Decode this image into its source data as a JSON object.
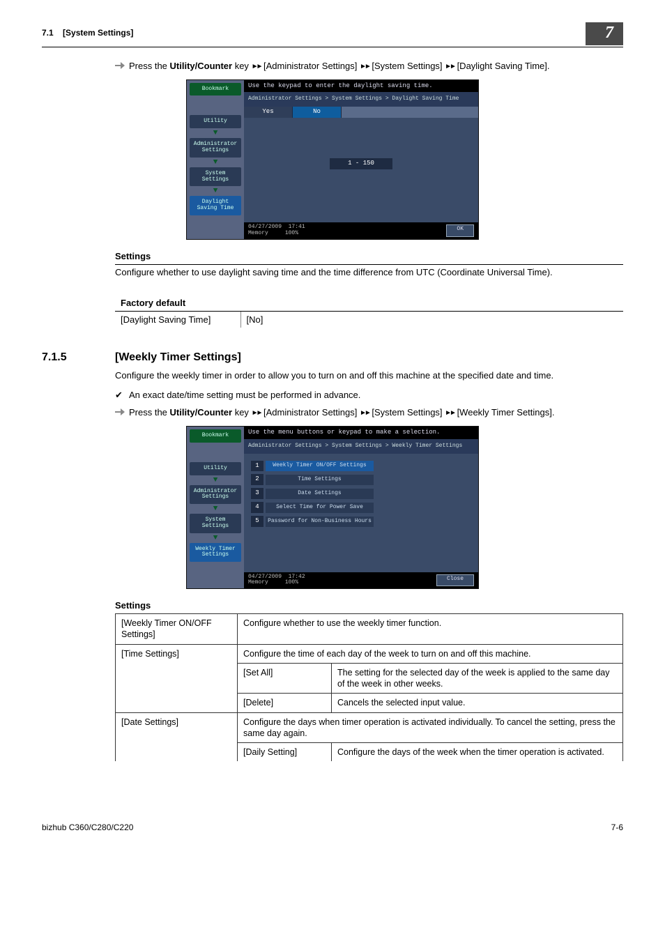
{
  "header": {
    "section_no": "7.1",
    "section_title": "[System Settings]",
    "chapter_badge": "7"
  },
  "instr1": {
    "prefix": "Press the ",
    "key_bold": "Utility/Counter",
    "key_after": " key ",
    "path": " [Administrator Settings] ",
    "path2": " [System Settings] ",
    "path3": " [Daylight Saving Time].",
    "triangle": "►►"
  },
  "lcd1": {
    "top_msg": "Use the keypad to enter the daylight saving time.",
    "crumb": "Administrator Settings > System Settings > Daylight Saving Time",
    "tab_yes": "Yes",
    "tab_no": "No",
    "side": {
      "bookmark": "Bookmark",
      "utility": "Utility",
      "admin": "Administrator Settings",
      "system": "System Settings",
      "dst": "Daylight Saving Time"
    },
    "center": "1  -  150",
    "status_date": "04/27/2009",
    "status_time": "17:41",
    "status_mem": "Memory",
    "status_pct": "100%",
    "ok": "OK"
  },
  "settings_h": "Settings",
  "settings_p1": "Configure whether to use daylight saving time and the time difference from UTC (Coordinate Universal Time).",
  "factory_h": "Factory default",
  "factory_row_label": "[Daylight Saving Time]",
  "factory_row_val": "[No]",
  "sec715_no": "7.1.5",
  "sec715_title": "[Weekly Timer Settings]",
  "sec715_intro": "Configure the weekly timer in order to allow you to turn on and off this machine at the specified date and time.",
  "check1": "An exact date/time setting must be performed in advance.",
  "instr2": {
    "prefix": "Press the ",
    "key_bold": "Utility/Counter",
    "key_after": " key ",
    "path": " [Administrator Settings] ",
    "path2": " [System Settings] ",
    "path3": " [Weekly Timer Settings].",
    "triangle": "►►"
  },
  "lcd2": {
    "top_msg": "Use the menu buttons or keypad to make a selection.",
    "crumb": "Administrator Settings > System Settings > Weekly Timer Settings",
    "side": {
      "bookmark": "Bookmark",
      "utility": "Utility",
      "admin": "Administrator Settings",
      "system": "System Settings",
      "weekly": "Weekly Timer Settings"
    },
    "menu": {
      "m1": "Weekly Timer ON/OFF Settings",
      "m2": "Time Settings",
      "m3": "Date Settings",
      "m4": "Select Time for Power Save",
      "m5": "Password for Non-Business Hours"
    },
    "status_date": "04/27/2009",
    "status_time": "17:42",
    "status_mem": "Memory",
    "status_pct": "100%",
    "close": "Close"
  },
  "tbl": {
    "r1_label": "[Weekly Timer ON/OFF Settings]",
    "r1_desc": "Configure whether to use the weekly timer function.",
    "r2_label": "[Time Settings]",
    "r2_desc": "Configure the time of each day of the week to turn on and off this machine.",
    "r2a_label": "[Set All]",
    "r2a_desc": "The setting for the selected day of the week is applied to the same day of the week in other weeks.",
    "r2b_label": "[Delete]",
    "r2b_desc": "Cancels the selected input value.",
    "r3_label": "[Date Settings]",
    "r3_desc": "Configure the days when timer operation is activated individually. To cancel the setting, press the same day again.",
    "r3a_label": "[Daily Setting]",
    "r3a_desc": "Configure the days of the week when the timer operation is activated."
  },
  "footer_left": "bizhub C360/C280/C220",
  "footer_right": "7-6"
}
